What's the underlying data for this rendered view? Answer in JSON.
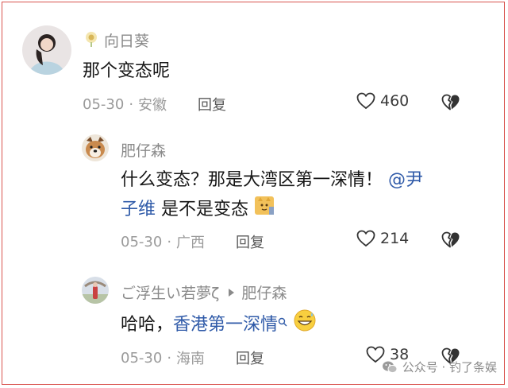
{
  "comments": [
    {
      "author": "向日葵",
      "text": "那个变态呢",
      "date": "05-30",
      "location": "安徽",
      "reply_label": "回复",
      "likes": "460"
    },
    {
      "author": "肥仔森",
      "text_line1_plain": "什么变态？那是大湾区第一深情！",
      "mention_part1": "@尹",
      "mention_part2": "子维",
      "text_line2_rest": " 是不是变态",
      "date": "05-30",
      "location": "广西",
      "reply_label": "回复",
      "likes": "214"
    },
    {
      "author": "ご浮生い若夢ζ",
      "reply_to": "肥仔森",
      "text_prefix": "哈哈，",
      "text_link": "香港第一深情",
      "date": "05-30",
      "location": "海南",
      "reply_label": "回复",
      "likes": "38"
    }
  ],
  "separator": "·",
  "watermark": "公众号 · 钓了条娱",
  "colors": {
    "mention": "#2f5aa8",
    "frame_border": "#d9534f"
  },
  "icons": [
    "sunflower-badge-icon",
    "heart-icon",
    "broken-heart-icon",
    "reply-arrow-icon",
    "search-icon",
    "grin-sweat-emoji",
    "cat-emoji",
    "wechat-icon"
  ]
}
